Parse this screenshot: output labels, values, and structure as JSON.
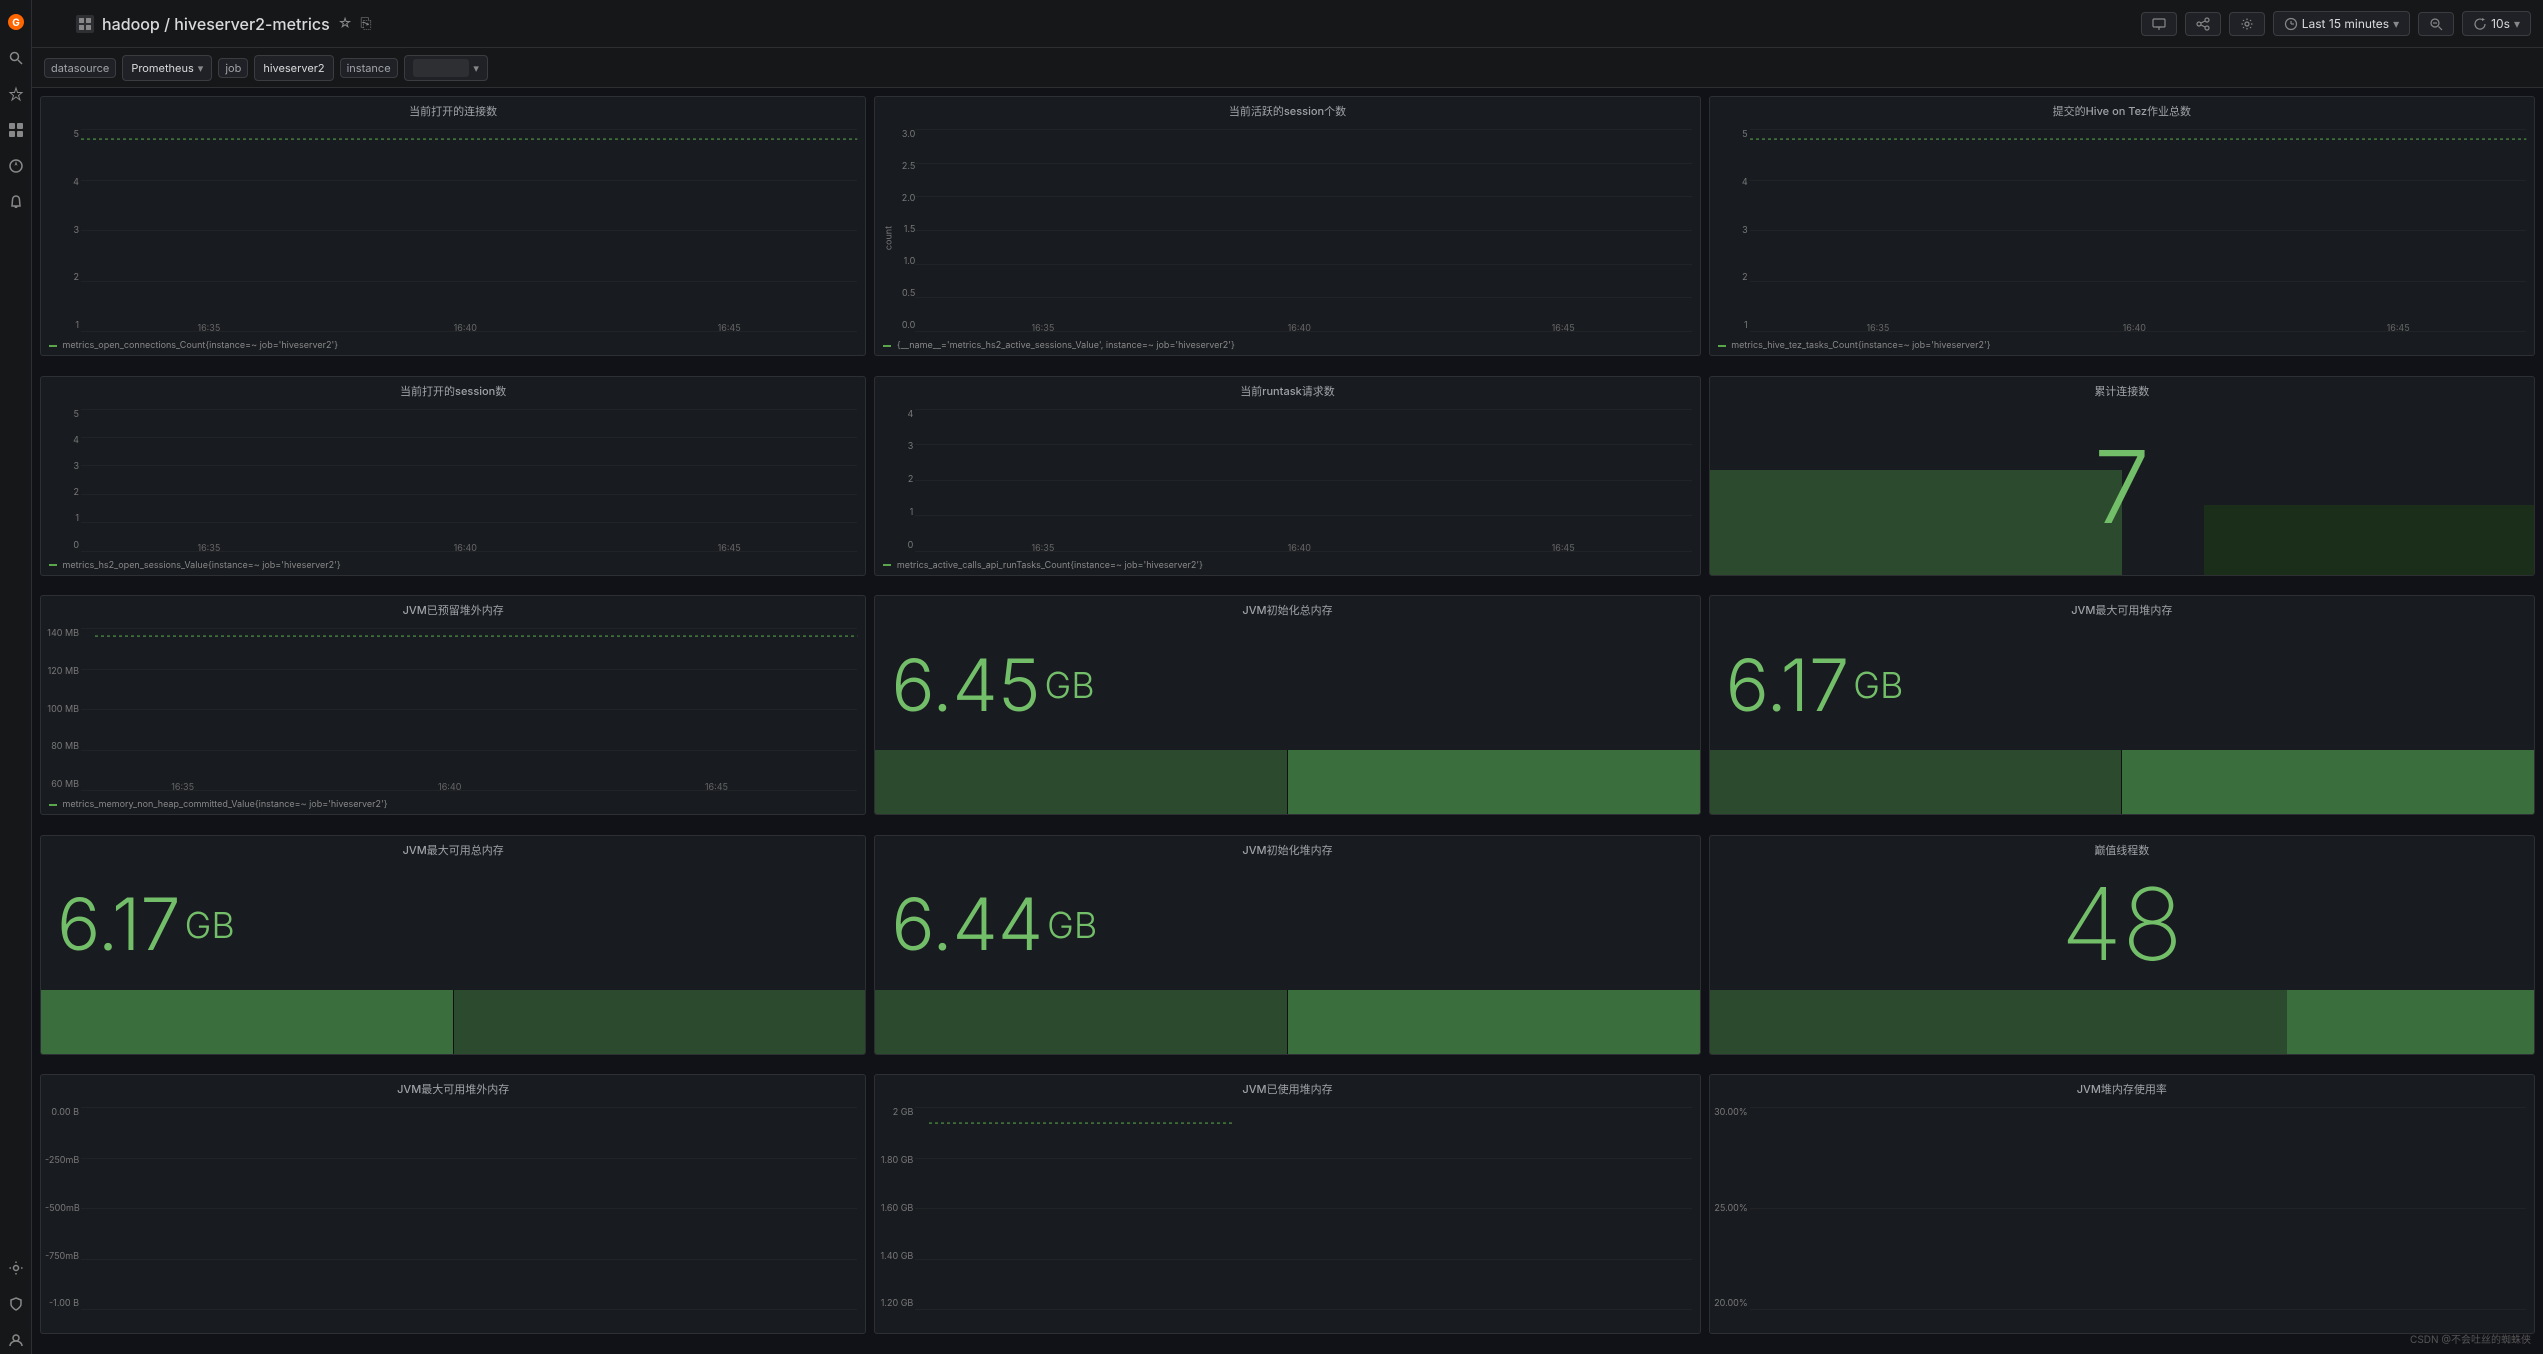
{
  "topbar": {
    "logo": "G",
    "breadcrumb": "hadoop / hiveserver2-metrics",
    "star_icon": "★",
    "share_icon": "⎘",
    "time_range": "Last 15 minutes",
    "refresh": "10s"
  },
  "filterbar": {
    "datasource_label": "datasource",
    "datasource_value": "Prometheus",
    "job_label": "job",
    "job_value": "hiveserver2",
    "instance_label": "instance",
    "instance_value": ""
  },
  "panels": {
    "row1": [
      {
        "title": "当前打开的连接数",
        "y_labels": [
          "5",
          "4",
          "3",
          "2",
          "1"
        ],
        "legend": "metrics_open_connections_Count{instance=~     job='hiveserver2'}"
      },
      {
        "title": "当前活跃的session个数",
        "y_labels": [
          "3.0",
          "2.5",
          "2.0",
          "1.5",
          "1.0",
          "0.5",
          "0.0"
        ],
        "y_label_left": "count",
        "legend": "{__name__='metrics_hs2_active_sessions_Value', instance=~     job='hiveserver2'}"
      },
      {
        "title": "提交的Hive on Tez作业总数",
        "y_labels": [
          "5",
          "4",
          "3",
          "2",
          "1"
        ],
        "legend": "metrics_hive_tez_tasks_Count{instance=~     job='hiveserver2'}"
      }
    ],
    "row2": [
      {
        "title": "当前打开的session数",
        "y_labels": [
          "5",
          "4",
          "3",
          "2",
          "1",
          "0"
        ],
        "legend": "metrics_hs2_open_sessions_Value{instance=~     job='hiveserver2'}"
      },
      {
        "title": "当前runtask请求数",
        "y_labels": [
          "4",
          "3",
          "2",
          "1",
          "0"
        ],
        "legend": "metrics_active_calls_api_runTasks_Count{instance=~     job='hiveserver2'}"
      },
      {
        "title": "累计连接数",
        "value": "7",
        "type": "stat"
      }
    ],
    "row3": [
      {
        "title": "JVM已预留堆外内存",
        "y_labels": [
          "140 MB",
          "120 MB",
          "100 MB",
          "80 MB",
          "60 MB"
        ],
        "legend": "metrics_memory_non_heap_committed_Value{instance=~     job='hiveserver2'}"
      },
      {
        "title": "JVM初始化总内存",
        "value": "6.45",
        "unit": "GB",
        "type": "bigstat"
      },
      {
        "title": "JVM最大可用堆内存",
        "value": "6.17",
        "unit": "GB",
        "type": "bigstat"
      },
      {
        "title": "JVM最大可用总内存",
        "value": "6.17",
        "unit": "GB",
        "type": "bigstat"
      },
      {
        "title": "JVM初始化堆内存",
        "value": "6.44",
        "unit": "GB",
        "type": "bigstat"
      },
      {
        "title": "巅值线程数",
        "value": "48",
        "type": "bigcount"
      }
    ],
    "row4": [
      {
        "title": "JVM最大可用堆外内存",
        "y_labels": [
          "0.00 B",
          "-250.00 mB",
          "-500.00 mB",
          "-750.00 mB",
          "-1.00 B"
        ],
        "legend": ""
      },
      {
        "title": "JVM已使用堆内存",
        "y_labels": [
          "2 GB",
          "1.80 GB",
          "1.60 GB",
          "1.40 GB",
          "1.20 GB"
        ],
        "legend": ""
      },
      {
        "title": "JVM堆内存使用率",
        "y_labels": [
          "30.00%",
          "25.00%",
          "20.00%"
        ],
        "legend": ""
      }
    ]
  },
  "timestamps": {
    "t1": "16:35",
    "t2": "16:40",
    "t3": "16:45"
  },
  "watermark": "CSDN @不会吐丝的蜘蛛侠"
}
